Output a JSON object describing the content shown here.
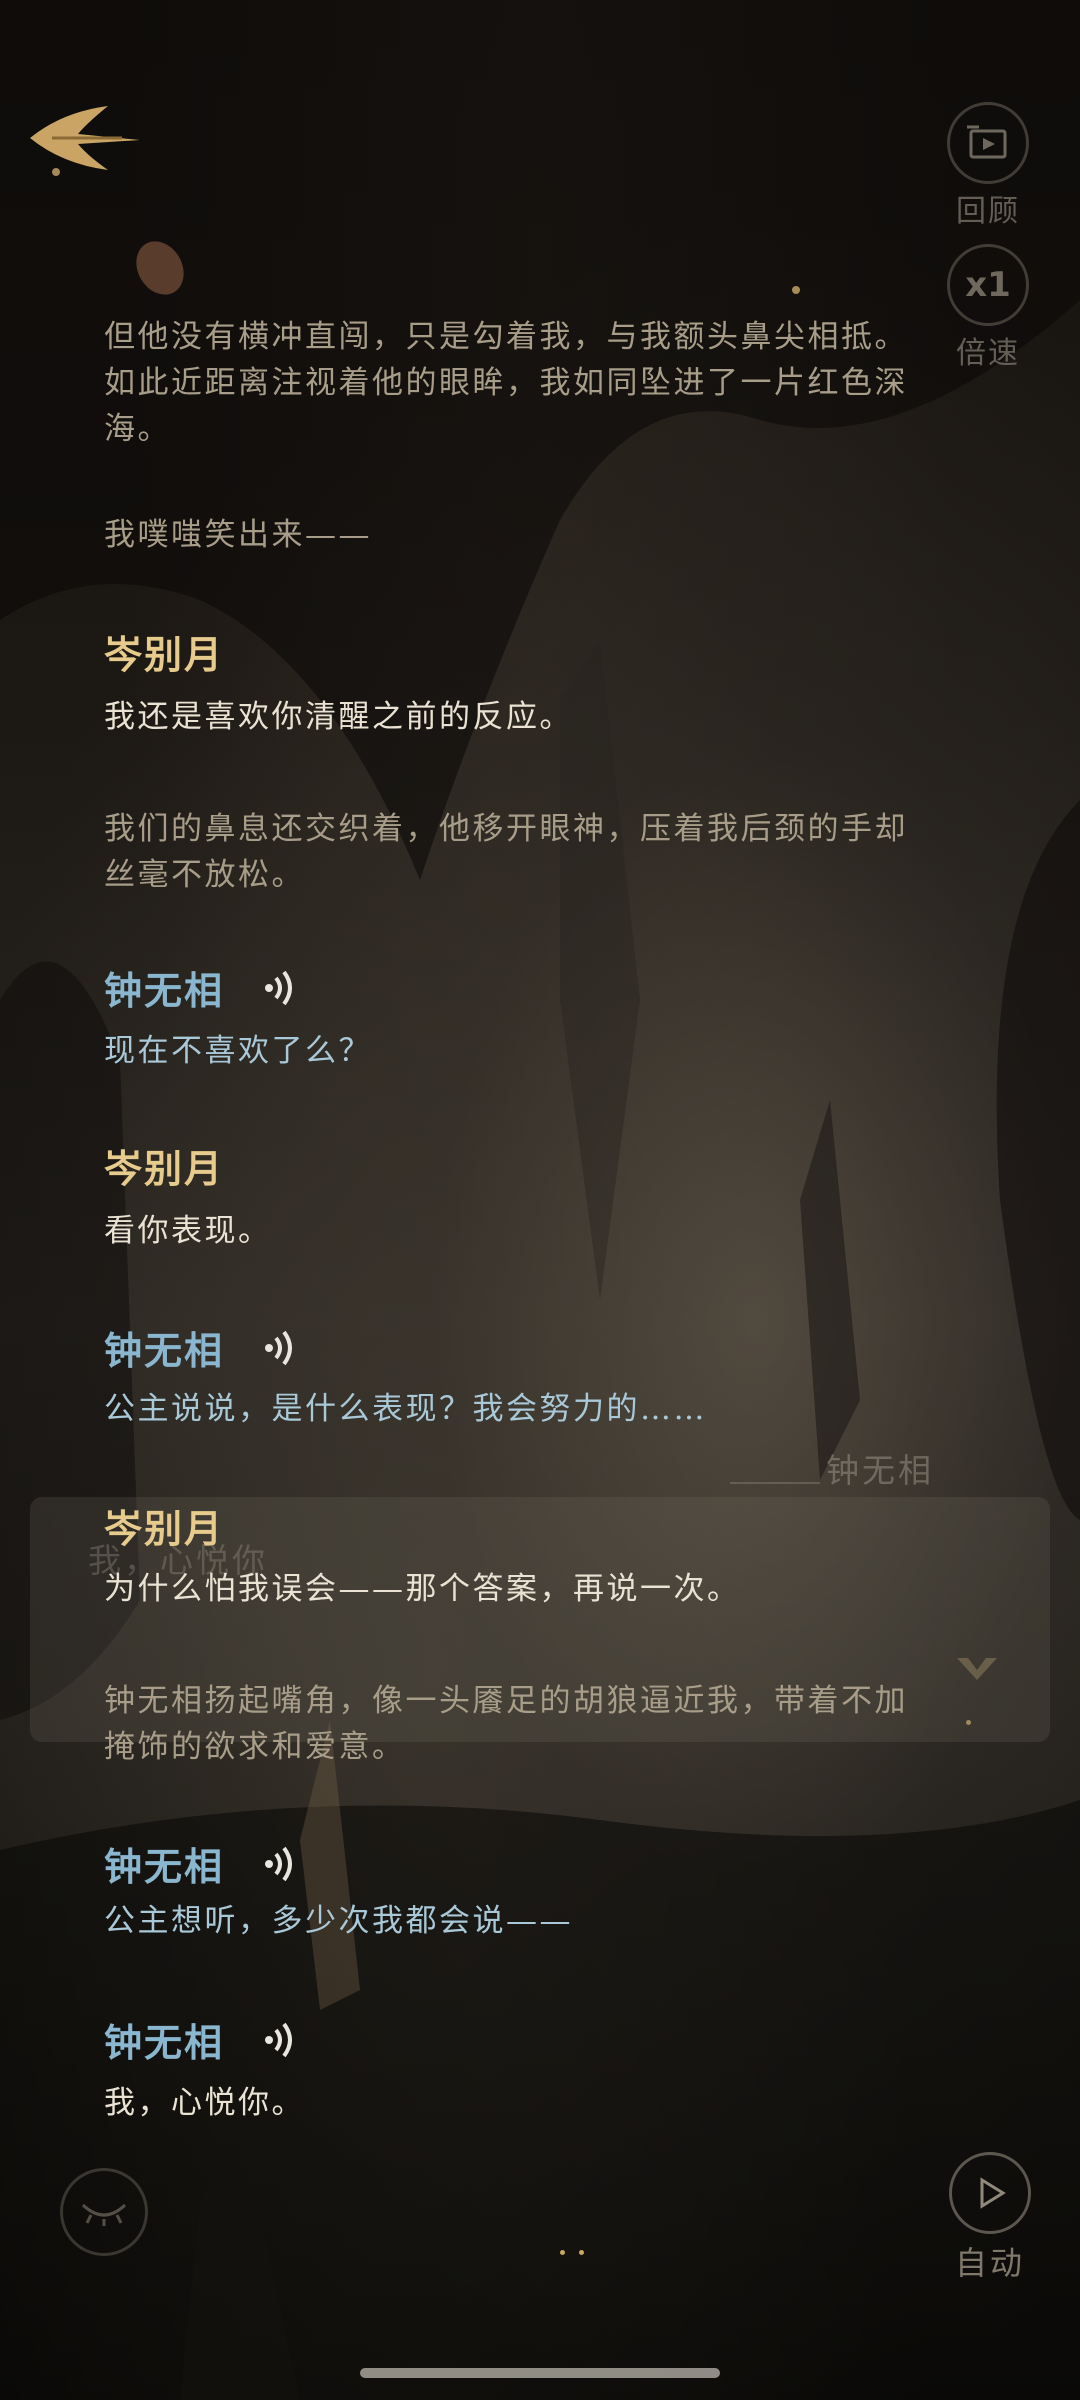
{
  "controls": {
    "review_label": "回顾",
    "speed_value": "x1",
    "speed_label": "倍速",
    "auto_label": "自动"
  },
  "dialog": {
    "n1": "但他没有横冲直闯，只是勾着我，与我额头鼻尖相抵。如此近距离注视着他的眼眸，我如同坠进了一片红色深海。",
    "n2": "我噗嗤笑出来——",
    "s1_name": "岑别月",
    "s1_line": "我还是喜欢你清醒之前的反应。",
    "n3": "我们的鼻息还交织着，他移开眼神，压着我后颈的手却丝毫不放松。",
    "s2_name": "钟无相",
    "s2_line": "现在不喜欢了么？",
    "s3_name": "岑别月",
    "s3_line": "看你表现。",
    "s4_name": "钟无相",
    "s4_line": "公主说说，是什么表现？我会努力的……",
    "s5_name": "岑别月",
    "s5_line": "为什么怕我误会——那个答案，再说一次。",
    "n4": "钟无相扬起嘴角，像一头餍足的胡狼逼近我，带着不加掩饰的欲求和爱意。",
    "s6_name": "钟无相",
    "s6_line": "公主想听，多少次我都会说——",
    "s7_name": "钟无相",
    "s7_line": "我，心悦你。"
  },
  "ghost": {
    "name": "钟无相",
    "text": "我，心悦你"
  },
  "colors": {
    "speaker_gold": "#e7cb8d",
    "speaker_blue": "#8ab6cf",
    "narration": "#a89d88"
  },
  "icons": [
    "back-arrow-icon",
    "review-icon",
    "voice-icon",
    "eye-closed-icon",
    "play-icon"
  ]
}
